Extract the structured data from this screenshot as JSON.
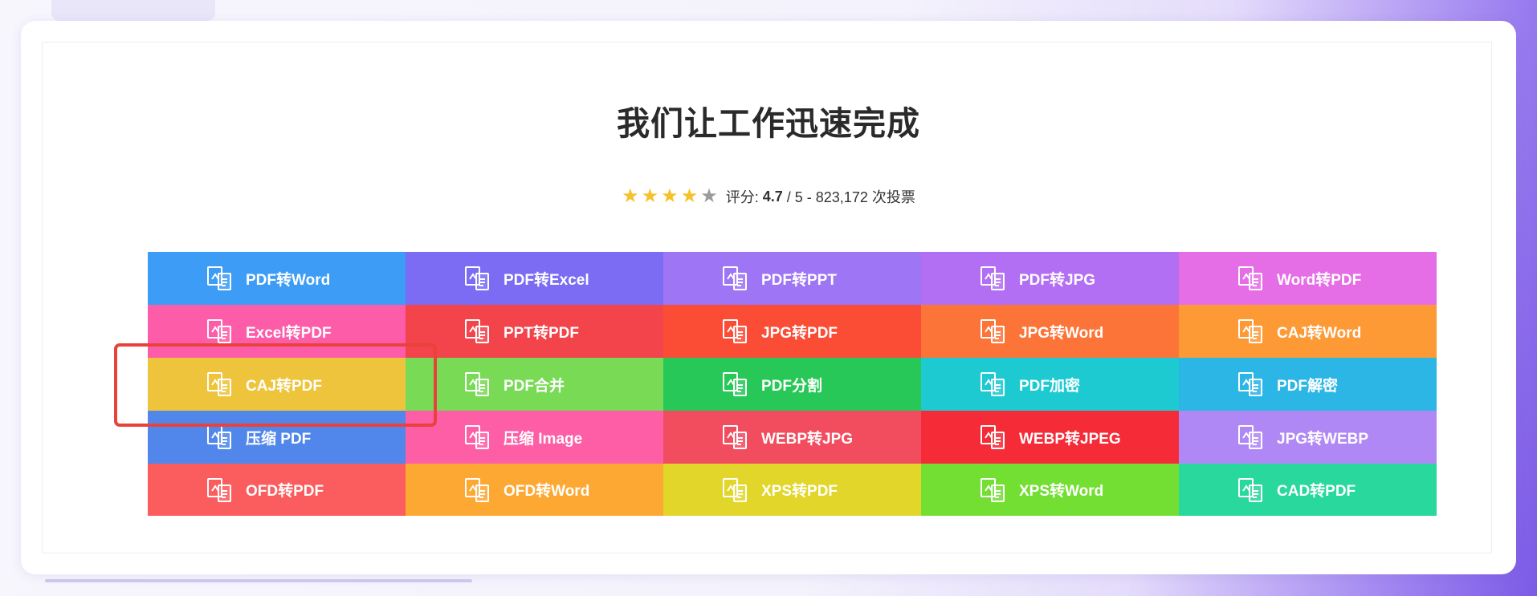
{
  "page": {
    "heading": "我们让工作迅速完成",
    "rating": {
      "label": "评分:",
      "score": "4.7",
      "suffix": "/ 5 - 823,172 次投票",
      "stars_filled": 4,
      "stars_total": 5
    }
  },
  "tools": [
    {
      "label": "PDF转Word",
      "color": "#3d9cf5",
      "icon": "pdf-doc-icon"
    },
    {
      "label": "PDF转Excel",
      "color": "#7b6cf3",
      "icon": "pdf-sheet-icon"
    },
    {
      "label": "PDF转PPT",
      "color": "#9d75f5",
      "icon": "pdf-ppt-icon"
    },
    {
      "label": "PDF转JPG",
      "color": "#b36ff4",
      "icon": "pdf-image-icon"
    },
    {
      "label": "Word转PDF",
      "color": "#e56ee6",
      "icon": "word-pdf-icon"
    },
    {
      "label": "Excel转PDF",
      "color": "#fd5ca8",
      "icon": "excel-pdf-icon"
    },
    {
      "label": "PPT转PDF",
      "color": "#f3434b",
      "icon": "ppt-pdf-icon"
    },
    {
      "label": "JPG转PDF",
      "color": "#fb4c36",
      "icon": "jpg-pdf-icon"
    },
    {
      "label": "JPG转Word",
      "color": "#fd7438",
      "icon": "jpg-word-icon"
    },
    {
      "label": "CAJ转Word",
      "color": "#fe9a36",
      "icon": "caj-word-icon"
    },
    {
      "label": "CAJ转PDF",
      "color": "#edc43c",
      "icon": "caj-pdf-icon"
    },
    {
      "label": "PDF合并",
      "color": "#78da55",
      "icon": "merge-icon"
    },
    {
      "label": "PDF分割",
      "color": "#27c857",
      "icon": "split-icon"
    },
    {
      "label": "PDF加密",
      "color": "#1dcad2",
      "icon": "lock-icon"
    },
    {
      "label": "PDF解密",
      "color": "#2bb6e6",
      "icon": "unlock-icon"
    },
    {
      "label": "压缩 PDF",
      "color": "#5187ea",
      "icon": "compress-pdf-icon"
    },
    {
      "label": "压缩 Image",
      "color": "#fd5ea5",
      "icon": "compress-image-icon"
    },
    {
      "label": "WEBP转JPG",
      "color": "#f24c5f",
      "icon": "webp-jpg-icon"
    },
    {
      "label": "WEBP转JPEG",
      "color": "#f52b38",
      "icon": "webp-jpeg-icon"
    },
    {
      "label": "JPG转WEBP",
      "color": "#b088f6",
      "icon": "jpg-webp-icon"
    },
    {
      "label": "OFD转PDF",
      "color": "#fb5c5d",
      "icon": "ofd-pdf-icon"
    },
    {
      "label": "OFD转Word",
      "color": "#fea834",
      "icon": "ofd-word-icon"
    },
    {
      "label": "XPS转PDF",
      "color": "#e2d62a",
      "icon": "xps-pdf-icon"
    },
    {
      "label": "XPS转Word",
      "color": "#74df33",
      "icon": "xps-word-icon"
    },
    {
      "label": "CAD转PDF",
      "color": "#29d89d",
      "icon": "cad-pdf-icon"
    }
  ],
  "highlighted_tool": "CAJ转PDF"
}
